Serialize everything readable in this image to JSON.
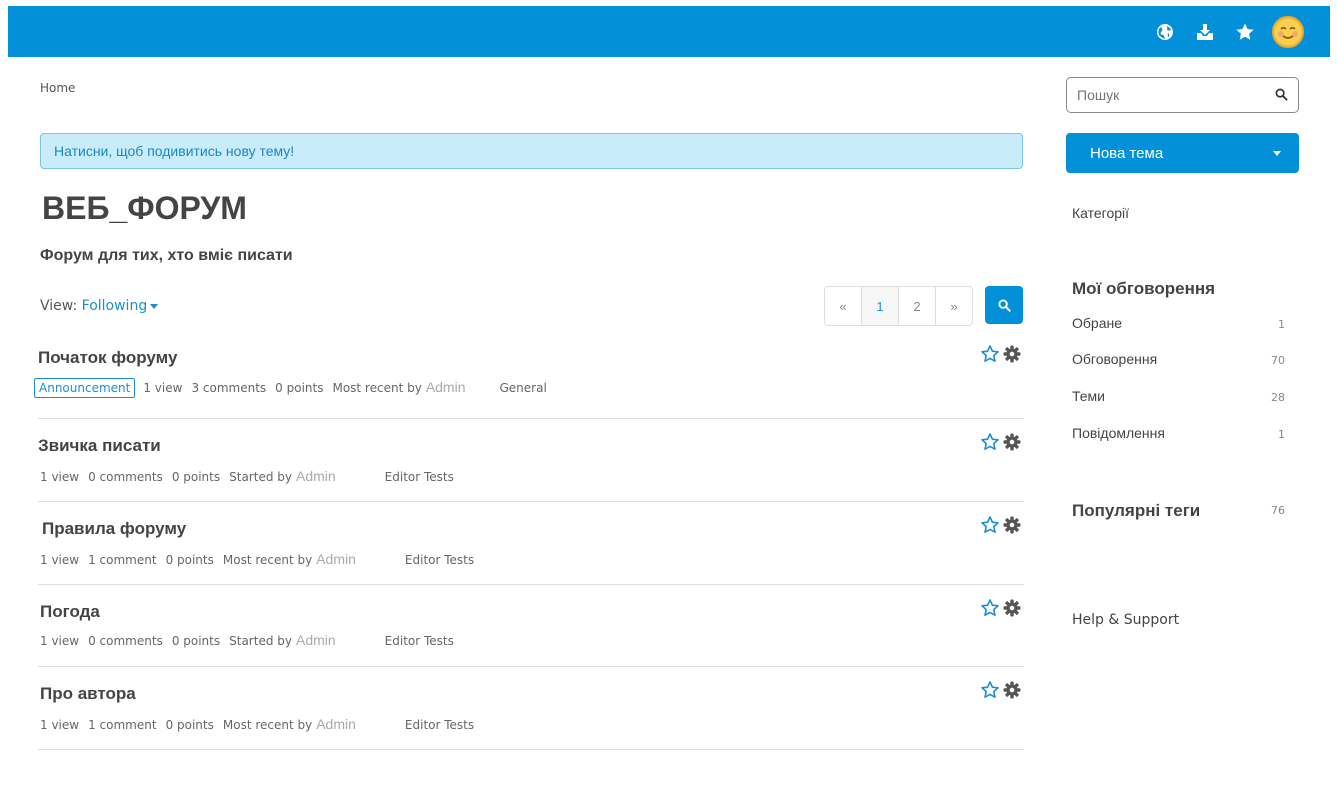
{
  "header": {
    "icons": [
      "globe-icon",
      "inbox-download-icon",
      "star-icon"
    ],
    "avatar": "smiley-avatar"
  },
  "breadcrumb": "Home",
  "notice": "Натисни, щоб подивитись нову тему!",
  "forum": {
    "title": "ВЕБ_ФОРУМ",
    "subtitle": "Форум для тих, хто вміє писати"
  },
  "view": {
    "label": "View:",
    "value": "Following"
  },
  "pager": {
    "prev": "«",
    "pages": [
      "1",
      "2"
    ],
    "next": "»",
    "current": "1"
  },
  "topics": [
    {
      "title": "Початок форуму",
      "badge": "Announcement",
      "views": "1 view",
      "comments": "3 comments",
      "points": "0 points",
      "by": "Most recent by",
      "author": "Admin",
      "category": "General"
    },
    {
      "title": "Звичка писати",
      "views": "1 view",
      "comments": "0 comments",
      "points": "0 points",
      "by": "Started by",
      "author": "Admin",
      "category": "Editor Tests"
    },
    {
      "title": "Правила форуму",
      "views": "1 view",
      "comments": "1 comment",
      "points": "0 points",
      "by": "Most recent by",
      "author": "Admin",
      "category": "Editor Tests"
    },
    {
      "title": "Погода",
      "views": "1 view",
      "comments": "0 comments",
      "points": "0 points",
      "by": "Started by",
      "author": "Admin",
      "category": "Editor Tests"
    },
    {
      "title": "Про автора",
      "views": "1 view",
      "comments": "1 comment",
      "points": "0 points",
      "by": "Most recent by",
      "author": "Admin",
      "category": "Editor Tests"
    }
  ],
  "sidebar": {
    "search_placeholder": "Пошук",
    "new_topic": "Нова тема",
    "categories": "Категорії",
    "my_discussions": "Мої обговорення",
    "items": [
      {
        "label": "Обране",
        "count": "1"
      },
      {
        "label": "Обговорення",
        "count": "70"
      },
      {
        "label": "Теми",
        "count": "28"
      },
      {
        "label": "Повідомлення",
        "count": "1"
      }
    ],
    "popular_tags": "Популярні теги",
    "popular_tags_count": "76",
    "help": "Help & Support"
  },
  "colors": {
    "accent": "#0291d9",
    "notice_bg": "#c9ecfa",
    "link": "#1a8fd0"
  }
}
